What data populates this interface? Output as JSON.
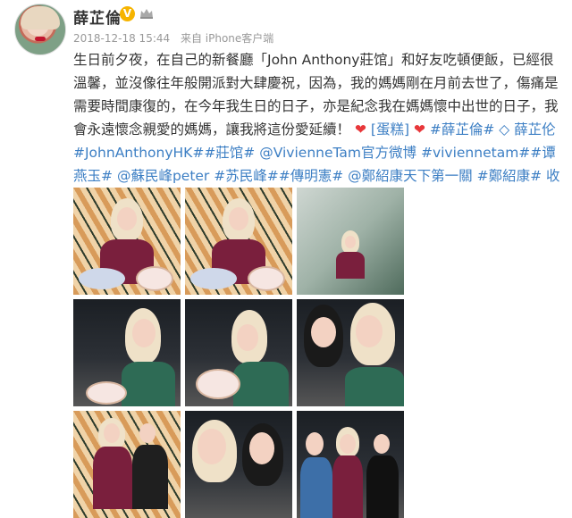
{
  "post": {
    "username": "薛芷倫",
    "verified_badge": "V",
    "meta": {
      "timestamp": "2018-12-18 15:44",
      "source": "来自 iPhone客户端"
    },
    "text_lines": {
      "p1": "生日前夕夜，在自己的新餐廳「John Anthony莊馆」和好友吃頓便飯，已經很溫馨，並沒像往年般開派對大肆慶祝，因為，我的媽媽剛在月前去世了，傷痛是需要時間康復的，在今年我生日的日子，亦是紀念我在媽媽懷中出世的日子，我會永遠懷念親愛的媽媽，讓我將這份愛延續！",
      "emoji_cake": "[蛋糕]",
      "tag1": "#薛芷倫#",
      "mention_label": "薛芷伦",
      "tag2": "#JohnAnthonyHK#",
      "tag3": "#莊馆#",
      "mention2": "@VivienneTam官方微博",
      "tag4": "#viviennetam#",
      "tag5": "#谭燕玉#",
      "mention3": "@蘇民峰peter",
      "tag6": "#苏民峰#",
      "tag7": "#傳明憲#",
      "mention4": "@鄭紹康天下第一關",
      "tag8": "#鄭紹康#",
      "collapse": "收起全文"
    }
  },
  "icons": {
    "heart": "heart-icon",
    "crown": "crown-icon",
    "location": "location-icon"
  },
  "colors": {
    "link": "#3d7fc4",
    "meta": "#999999",
    "badge": "#f6b400",
    "heart": "#e8373a"
  }
}
